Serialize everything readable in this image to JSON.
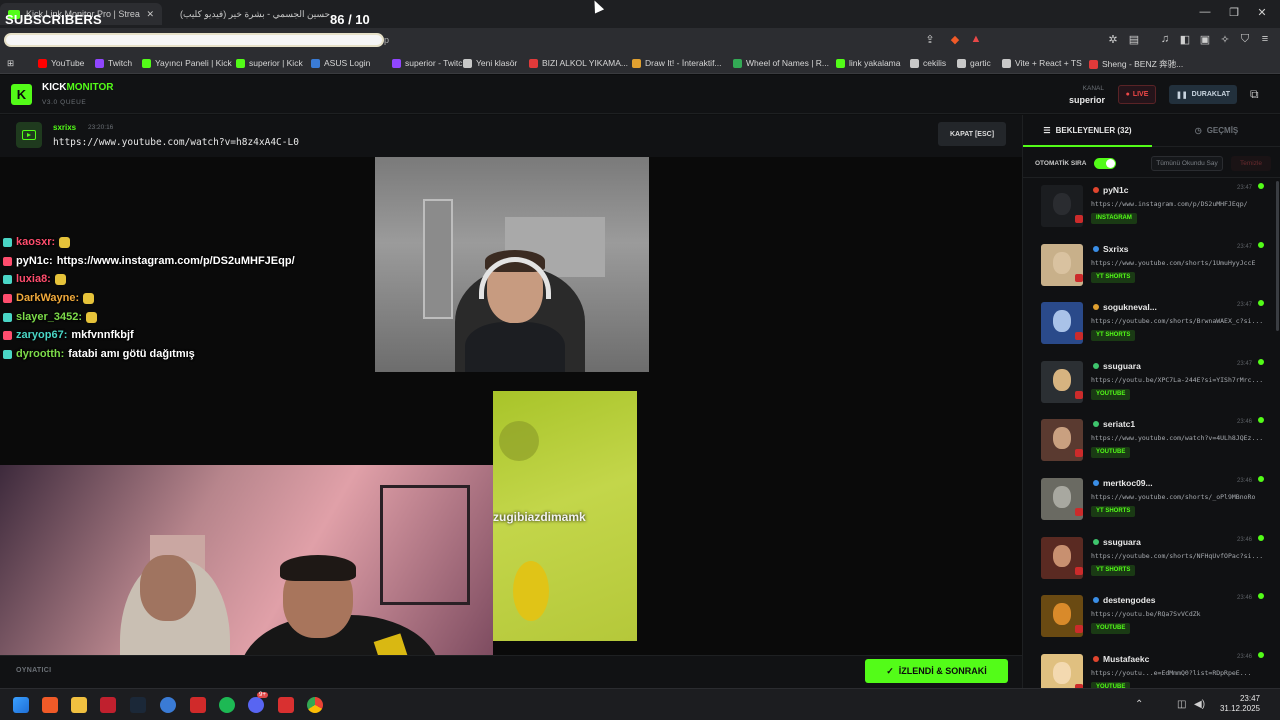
{
  "overlay": {
    "subscribers_label": "SUBSCRIBERS",
    "sub_count": "86  / 10"
  },
  "tabs": [
    {
      "title": "Kick Link Monitor Pro | Strea",
      "active": true
    },
    {
      "title": "حسين الجسمي - بشرة خير (فيديو كليب)"
    }
  ],
  "window_controls": {
    "minimize": "—",
    "restore": "❐",
    "close": "✕"
  },
  "address": {
    "tail": "p"
  },
  "bookmarks": [
    {
      "label": "YouTube",
      "color": "#ff0000"
    },
    {
      "label": "Twitch",
      "color": "#9146ff"
    },
    {
      "label": "Yayıncı Paneli | Kick",
      "color": "#53fc18"
    },
    {
      "label": "superior | Kick",
      "color": "#53fc18"
    },
    {
      "label": "ASUS Login",
      "color": "#3a7bd5"
    },
    {
      "label": "superior - Twitch",
      "color": "#9146ff"
    },
    {
      "label": "Yeni klasör",
      "color": "#c8c8c8"
    },
    {
      "label": "BIZI ALKOL YIKAMA...",
      "color": "#e03a3a"
    },
    {
      "label": "Draw It! - İnteraktif...",
      "color": "#e0a030"
    },
    {
      "label": "Wheel of Names | R...",
      "color": "#33aa55"
    },
    {
      "label": "link yakalama",
      "color": "#53fc18"
    },
    {
      "label": "cekilis",
      "color": "#c8c8c8"
    },
    {
      "label": "gartic",
      "color": "#c8c8c8"
    },
    {
      "label": "Vite + React + TS",
      "color": "#c8c8c8"
    },
    {
      "label": "Sheng - BENZ 奔驰...",
      "color": "#e03a3a"
    }
  ],
  "app": {
    "logo_letter": "K",
    "brand_main": "KICK",
    "brand_accent": "MONITOR",
    "version": "V3.0 QUEUE",
    "kanal_label": "KANAL",
    "kanal_value": "superior",
    "live_label": "LIVE",
    "pause_label": "DURAKLAT"
  },
  "current": {
    "user": "sxrixs",
    "time": "23:20:16",
    "url": "https://www.youtube.com/watch?v=h8z4xA4C-L0",
    "close_label": "KAPAT [ESC]"
  },
  "video": {
    "caption": "zugibiazdimamk"
  },
  "chat": [
    {
      "user": "kaosxr:",
      "text": "",
      "color": "#ff4d6d"
    },
    {
      "user": "pyN1c:",
      "text": "https://www.instagram.com/p/DS2uMHFJEqp/",
      "color": "#ffffff"
    },
    {
      "user": "luxia8:",
      "text": "",
      "color": "#ff4d6d"
    },
    {
      "user": "DarkWayne:",
      "text": "",
      "color": "#f0a93b"
    },
    {
      "user": "slayer_3452:",
      "text": "",
      "color": "#7ddc4a"
    },
    {
      "user": "zaryop67:",
      "text": "mkfvnnfkbjf",
      "color": "#4ad6c6"
    },
    {
      "user": "dyrootth:",
      "text": "fatabi amı götü dağıtmış",
      "color": "#7ddc4a"
    }
  ],
  "bottom": {
    "player_label": "OYNATICI",
    "next_label": "İZLENDİ & SONRAKİ"
  },
  "panel": {
    "tab_waiting": "BEKLEYENLER (32)",
    "tab_history": "GEÇMİŞ",
    "auto_label": "OTOMATİK SIRA",
    "auto_on": true,
    "mark_all": "Tümünü Okundu Say",
    "clear": "Temizle",
    "items": [
      {
        "name": "pyN1c",
        "time": "23:47",
        "url": "https://www.instagram.com/p/DS2uMHFJEqp/",
        "tag": "INSTAGRAM",
        "dot": "#e0452e"
      },
      {
        "name": "Sxrixs",
        "time": "23:47",
        "url": "https://www.youtube.com/shorts/1UmuHyyJccE",
        "tag": "YT SHORTS",
        "dot": "#3a8ee6"
      },
      {
        "name": "sogukneval...",
        "time": "23:47",
        "url": "https://youtube.com/shorts/BrwnaWAEX_c?si...",
        "tag": "YT SHORTS",
        "dot": "#e0a030"
      },
      {
        "name": "ssuguara",
        "time": "23:47",
        "url": "https://youtu.be/XPC7La-244E?si=YISh7rMrc...",
        "tag": "YOUTUBE",
        "dot": "#3ec46d"
      },
      {
        "name": "seriatc1",
        "time": "23:46",
        "url": "https://www.youtube.com/watch?v=4ULh8JQEz...",
        "tag": "YOUTUBE",
        "dot": "#3ec46d"
      },
      {
        "name": "mertkoc09...",
        "time": "23:46",
        "url": "https://www.youtube.com/shorts/_oPl9MBnoRo",
        "tag": "YT SHORTS",
        "dot": "#3a8ee6"
      },
      {
        "name": "ssuguara",
        "time": "23:46",
        "url": "https://youtube.com/shorts/NFHqUvfOPac?si...",
        "tag": "YT SHORTS",
        "dot": "#3ec46d"
      },
      {
        "name": "destengodes",
        "time": "23:46",
        "url": "https://youtu.be/RQa7SvVCdZk",
        "tag": "YOUTUBE",
        "dot": "#3a8ee6"
      },
      {
        "name": "Mustafaekc",
        "time": "23:46",
        "url": "https://youtu...e=EdMmmQ0?list=RDpRpeE...",
        "tag": "YOUTUBE",
        "dot": "#e0452e"
      }
    ]
  },
  "taskbar": {
    "time": "23:47",
    "date": "31.12.2025",
    "badge": "9+"
  }
}
